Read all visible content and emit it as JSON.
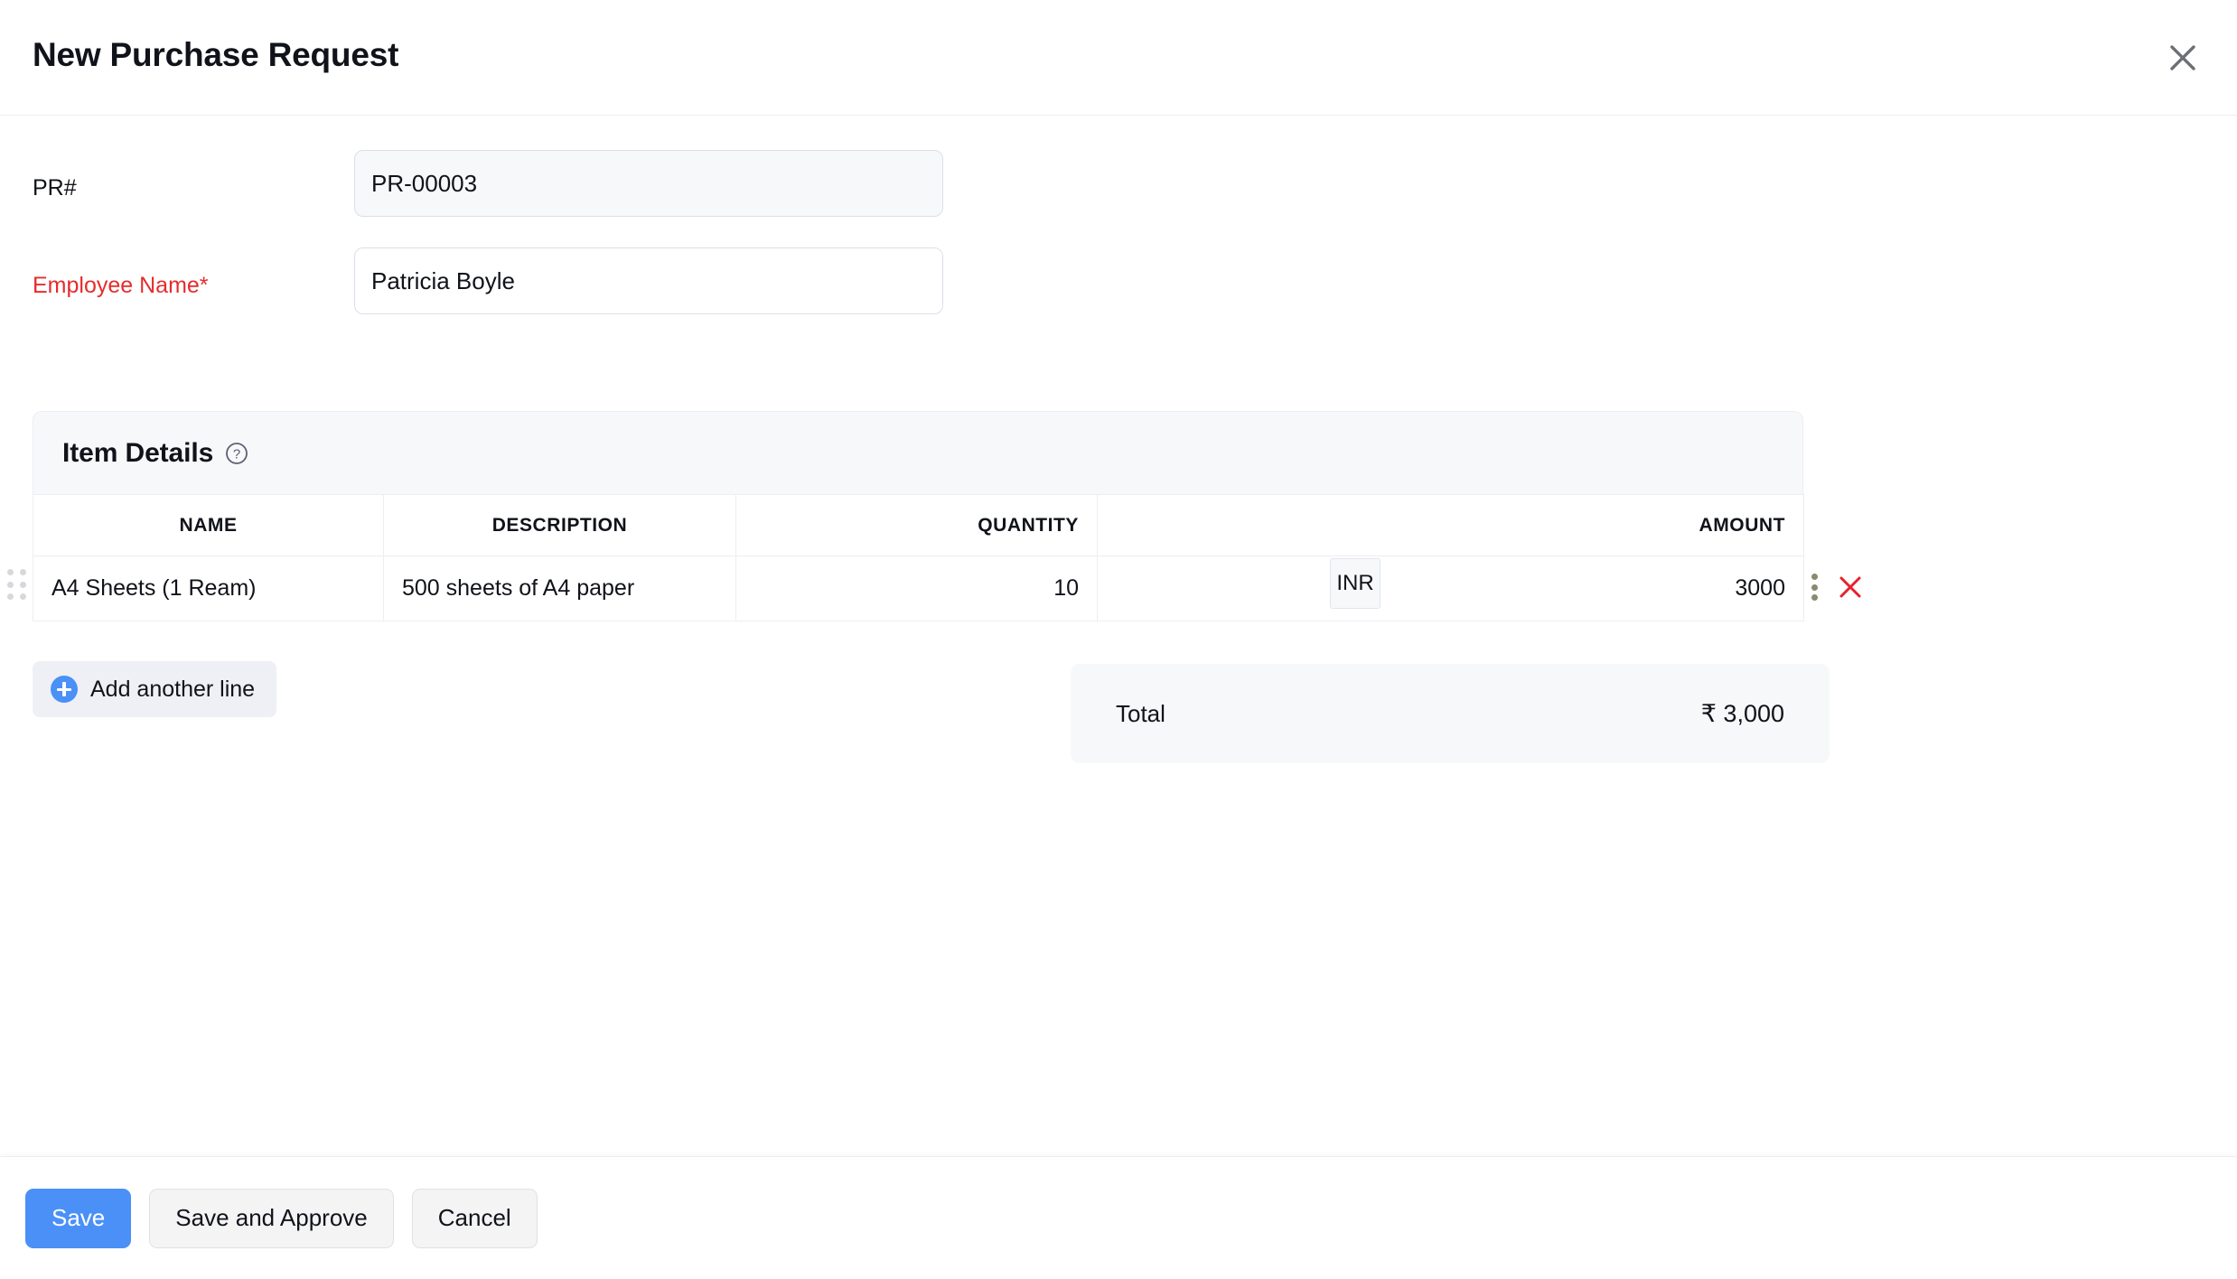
{
  "header": {
    "title": "New Purchase Request",
    "close_icon": "close-icon"
  },
  "form": {
    "fields": [
      {
        "label": "PR#",
        "value": "PR-00003",
        "placeholder": "",
        "required": false,
        "readonly": true
      },
      {
        "label": "Employee Name*",
        "value": "Patricia Boyle",
        "placeholder": "",
        "required": true,
        "readonly": false
      }
    ]
  },
  "item_details": {
    "title": "Item Details",
    "help_icon": "help-circle-icon",
    "columns": [
      "NAME",
      "DESCRIPTION",
      "QUANTITY",
      "AMOUNT"
    ],
    "rows": [
      {
        "name": "A4 Sheets (1 Ream)",
        "description": "500 sheets of A4 paper",
        "quantity": "10",
        "currency": "INR",
        "amount": "3000",
        "menu_icon": "kebab-menu-icon",
        "delete_icon": "delete-x-icon",
        "drag_icon": "drag-handle-icon"
      }
    ],
    "add_line_label": "Add another line",
    "add_line_icon": "plus-circle-icon"
  },
  "totals": {
    "label": "Total",
    "value": "₹ 3,000"
  },
  "footer": {
    "save_label": "Save",
    "save_approve_label": "Save and Approve",
    "cancel_label": "Cancel"
  },
  "colors": {
    "accent": "#4a90f7",
    "required": "#e62c2c",
    "delete": "#e8202a",
    "panel": "#f7f8fa",
    "border": "#eceef3"
  }
}
